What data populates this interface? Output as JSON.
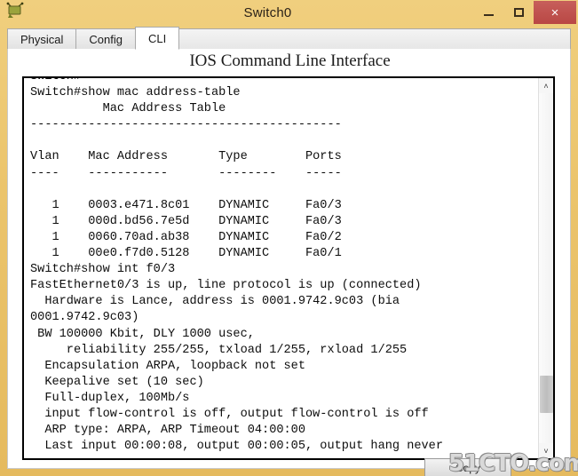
{
  "window": {
    "title": "Switch0",
    "app_icon": "network-device-icon",
    "controls": {
      "minimize": "minimize-icon",
      "maximize": "maximize-icon",
      "close": "×"
    }
  },
  "tabs": [
    {
      "label": "Physical",
      "active": false
    },
    {
      "label": "Config",
      "active": false
    },
    {
      "label": "CLI",
      "active": true
    }
  ],
  "panel": {
    "heading": "IOS Command Line Interface"
  },
  "terminal": {
    "lines": [
      "Switch#",
      "Switch#show mac address-table",
      "          Mac Address Table",
      "-------------------------------------------",
      "",
      "Vlan    Mac Address       Type        Ports",
      "----    -----------       --------    -----",
      "",
      "   1    0003.e471.8c01    DYNAMIC     Fa0/3",
      "   1    000d.bd56.7e5d    DYNAMIC     Fa0/3",
      "   1    0060.70ad.ab38    DYNAMIC     Fa0/2",
      "   1    00e0.f7d0.5128    DYNAMIC     Fa0/1",
      "Switch#show int f0/3",
      "FastEthernet0/3 is up, line protocol is up (connected)",
      "  Hardware is Lance, address is 0001.9742.9c03 (bia",
      "0001.9742.9c03)",
      " BW 100000 Kbit, DLY 1000 usec,",
      "     reliability 255/255, txload 1/255, rxload 1/255",
      "  Encapsulation ARPA, loopback not set",
      "  Keepalive set (10 sec)",
      "  Full-duplex, 100Mb/s",
      "  input flow-control is off, output flow-control is off",
      "  ARP type: ARPA, ARP Timeout 04:00:00",
      "  Last input 00:00:08, output 00:00:05, output hang never"
    ]
  },
  "scrollbar": {
    "up_arrow": "˄",
    "down_arrow": "˅"
  },
  "buttons": {
    "copy": "Copy"
  },
  "watermark": {
    "text": "51CTO.com"
  },
  "colors": {
    "window_frame": "#ebc46c",
    "close_button": "#c0504d",
    "terminal_bg": "#ffffff",
    "terminal_text": "#0d0d0d"
  }
}
